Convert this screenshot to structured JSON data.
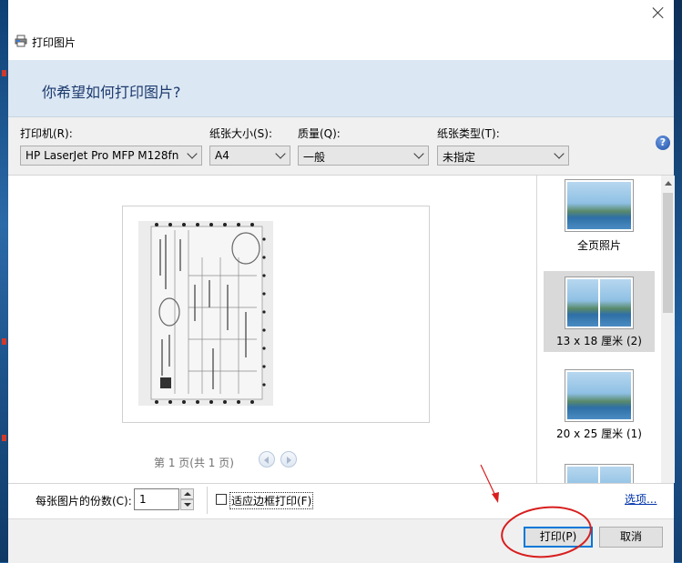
{
  "window": {
    "title": "打印图片"
  },
  "banner": {
    "heading": "你希望如何打印图片?"
  },
  "toolbar": {
    "printer_label": "打印机(R):",
    "printer_value": "HP LaserJet Pro MFP M128fn",
    "paper_size_label": "纸张大小(S):",
    "paper_size_value": "A4",
    "quality_label": "质量(Q):",
    "quality_value": "一般",
    "paper_type_label": "纸张类型(T):",
    "paper_type_value": "未指定",
    "help_glyph": "?"
  },
  "preview": {
    "page_indicator": "第 1 页(共 1 页)"
  },
  "layouts": {
    "items": [
      {
        "label": "全页照片"
      },
      {
        "label": "13 x 18 厘米 (2)"
      },
      {
        "label": "20 x 25 厘米 (1)"
      }
    ],
    "selected_index": 1
  },
  "options": {
    "copies_label": "每张图片的份数(C):",
    "copies_value": "1",
    "fit_frame_label": "适应边框打印(F)",
    "fit_frame_checked": false,
    "options_link": "选项..."
  },
  "buttons": {
    "print": "打印(P)",
    "cancel": "取消"
  },
  "icons": {
    "title": "printer-icon",
    "close": "close-icon",
    "help": "help-icon"
  },
  "colors": {
    "accent": "#0078d7",
    "banner": "#dbe7f3",
    "annotation_red": "#d81e1e"
  }
}
